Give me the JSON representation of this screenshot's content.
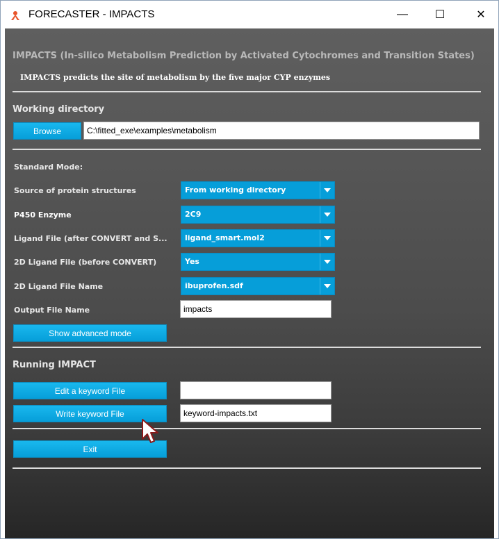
{
  "window": {
    "title": "FORECASTER - IMPACTS",
    "controls": {
      "minimize": "—",
      "maximize": "☐",
      "close": "✕"
    }
  },
  "header": {
    "title": "IMPACTS (In-silico Metabolism Prediction by Activated Cytochromes and Transition States)",
    "subtitle": "IMPACTS predicts the site of metabolism by the five major CYP enzymes"
  },
  "working_directory": {
    "heading": "Working directory",
    "browse_label": "Browse",
    "path": "C:\\fitted_exe\\examples\\metabolism"
  },
  "standard_mode": {
    "heading": "Standard Mode:",
    "rows": [
      {
        "label": "Source of protein structures",
        "value": "From working directory"
      },
      {
        "label": "P450 Enzyme",
        "value": "2C9"
      },
      {
        "label": "Ligand File (after CONVERT and S...",
        "value": "ligand_smart.mol2"
      },
      {
        "label": "2D Ligand File (before CONVERT)",
        "value": "Yes"
      },
      {
        "label": "2D Ligand File Name",
        "value": "ibuprofen.sdf"
      }
    ],
    "output_label": "Output File Name",
    "output_value": "impacts",
    "advanced_button": "Show advanced mode"
  },
  "running": {
    "heading": "Running IMPACT",
    "edit_button": "Edit a keyword File",
    "edit_value": "",
    "write_button": "Write keyword File",
    "write_value": "keyword-impacts.txt",
    "exit_button": "Exit"
  },
  "colors": {
    "accent": "#069ed9",
    "panel_dark": "#4c4c4c",
    "rule": "#dcdcdc"
  }
}
